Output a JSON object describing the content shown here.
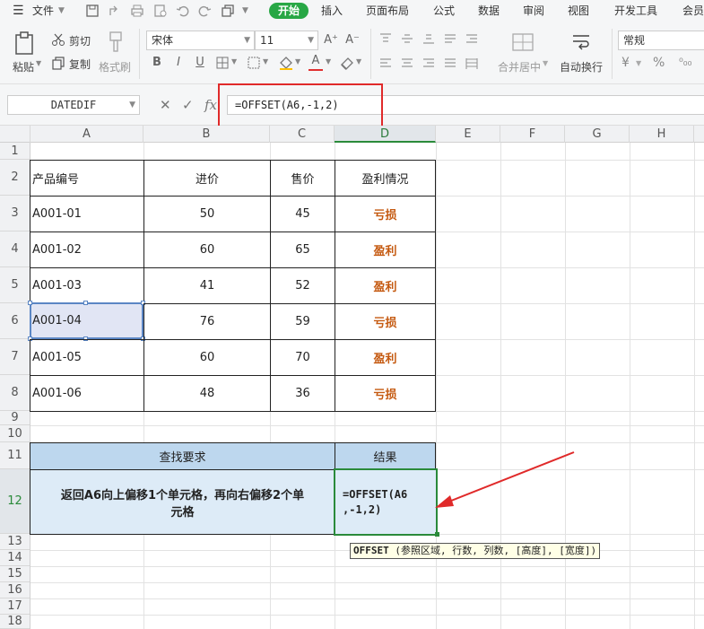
{
  "menubar": {
    "file_label": "文件",
    "tabs": [
      "开始",
      "插入",
      "页面布局",
      "公式",
      "数据",
      "审阅",
      "视图",
      "开发工具",
      "会员"
    ]
  },
  "ribbon": {
    "paste_label": "粘贴",
    "cut_label": "剪切",
    "copy_label": "复制",
    "format_painter_label": "格式刷",
    "font_name": "宋体",
    "font_size": "11",
    "merge_label": "合并居中",
    "wrap_label": "自动换行",
    "number_format": "常规",
    "bold_glyph": "B",
    "italic_glyph": "I",
    "underline_glyph": "U",
    "font_grow": "A⁺",
    "font_shrink": "A⁻",
    "font_color_glyph": "A",
    "currency_glyph": "¥",
    "percent_glyph": "%"
  },
  "formula_bar": {
    "name_box": "DATEDIF",
    "cancel_glyph": "✕",
    "confirm_glyph": "✓",
    "fx_glyph": "fx",
    "formula": "=OFFSET(A6,-1,2)"
  },
  "columns": [
    "A",
    "B",
    "C",
    "D",
    "E",
    "F",
    "G",
    "H"
  ],
  "rows": [
    "1",
    "2",
    "3",
    "4",
    "5",
    "6",
    "7",
    "8",
    "9",
    "10",
    "11",
    "12",
    "13",
    "14",
    "15",
    "16",
    "17",
    "18"
  ],
  "table": {
    "headers": [
      "产品编号",
      "进价",
      "售价",
      "盈利情况"
    ],
    "rows": [
      [
        "A001-01",
        "50",
        "45",
        "亏损"
      ],
      [
        "A001-02",
        "60",
        "65",
        "盈利"
      ],
      [
        "A001-03",
        "41",
        "52",
        "盈利"
      ],
      [
        "A001-04",
        "76",
        "59",
        "亏损"
      ],
      [
        "A001-05",
        "60",
        "70",
        "盈利"
      ],
      [
        "A001-06",
        "48",
        "36",
        "亏损"
      ]
    ]
  },
  "lookup": {
    "header_left": "查找要求",
    "header_right": "结果",
    "requirement_line1": "返回A6向上偏移1个单元格，再向右偏移2个单",
    "requirement_line2": "元格",
    "editing_line1": "=OFFSET(A6",
    "editing_line2": ",-1,2)"
  },
  "tooltip": {
    "function_name": "OFFSET",
    "args": " (参照区域, 行数, 列数, [高度], [宽度])"
  },
  "colors": {
    "accent_green": "#28a745",
    "highlight_red": "#e02a2a",
    "header_blue": "#bdd7ee",
    "result_orange": "#c55a11"
  }
}
